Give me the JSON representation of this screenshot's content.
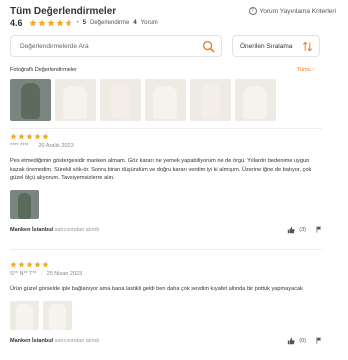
{
  "header": {
    "title": "Tüm Değerlendirmeler",
    "criteria_label": "Yorum Yayınlama Kriterleri",
    "criteria_icon": "question-circle-icon"
  },
  "summary": {
    "average": "4.6",
    "rating": 4.6,
    "review_count": "5",
    "review_label": "Değerlendirme",
    "comment_count": "4",
    "comment_label": "Yorum"
  },
  "search": {
    "placeholder": "Değerlendirmelerde Ara",
    "icon": "search-icon"
  },
  "sort": {
    "label": "Önerilen Sıralama",
    "icon": "sort-arrows-icon"
  },
  "photos": {
    "label": "Fotoğraflı Değerlendirmeler",
    "all_label": "Tümü",
    "count": 6
  },
  "reviews": [
    {
      "rating": 5,
      "user": "**** ****",
      "date": "20 Aralık 2023",
      "text": "Pes etmediğimin göstergesidir manken almam. Göz kararı ne yemek yapabiliyorum ne de örgü. Yıllardır bedenime uygun kazak öremedim. Sürekli sök-ör. Sonra biran düşündüm ve doğru kararı verdim iyi ki almışım. Üzerine iğne de batıyor, çok güzel ölçü alıyorum. Tavsiyemsizlerre alın.",
      "seller": "Manken İstanbul",
      "seller_suffix": "satıcısından alındı",
      "likes": "(3)"
    },
    {
      "rating": 5,
      "user": "S** N** T**",
      "date": "25 Nisan 2023",
      "text": "Ürün güzel görselde iple bağlanıyor ama bana lastikli geldi ben daha çok sevdim kıyafet altında bir pottuk yapmayacak",
      "seller": "Manken İstanbul",
      "seller_suffix": "satıcısından alındı",
      "likes": "(0)"
    }
  ],
  "colors": {
    "accent": "#f27a1a",
    "star": "#f5a623"
  }
}
